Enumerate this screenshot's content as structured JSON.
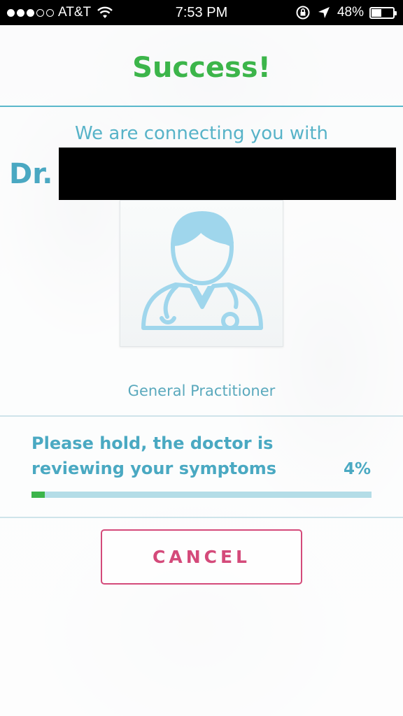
{
  "status_bar": {
    "carrier": "AT&T",
    "time": "7:53 PM",
    "battery_percent": "48%",
    "battery_level": 0.48,
    "signal_bars_filled": 3,
    "signal_bars_total": 5
  },
  "header": {
    "title": "Success!"
  },
  "doctor": {
    "intro": "We are connecting you with",
    "prefix": "Dr.",
    "name_redacted": true,
    "avatar_icon": "doctor-avatar-icon",
    "specialty": "General Practitioner"
  },
  "progress": {
    "message": "Please hold, the doctor is reviewing your symptoms",
    "percent_label": "4%",
    "value": 0.04
  },
  "actions": {
    "cancel_label": "CANCEL"
  },
  "colors": {
    "success_green": "#3cb54a",
    "teal": "#4aa9c2",
    "cancel_pink": "#d44a7a",
    "progress_track": "#b4dde7"
  }
}
